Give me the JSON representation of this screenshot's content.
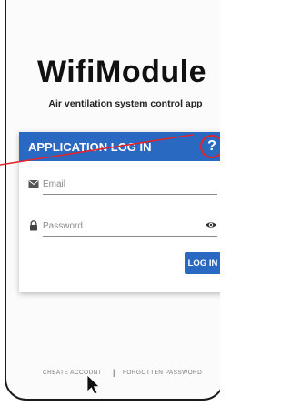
{
  "app": {
    "title": "WifiModule",
    "subtitle": "Air ventilation system control app"
  },
  "card": {
    "title": "APPLICATION LOG IN",
    "help_label": "?"
  },
  "form": {
    "email_placeholder": "Email",
    "password_placeholder": "Password",
    "login_label": "LOG IN"
  },
  "footer": {
    "create_account": "CREATE ACCOUNT",
    "separator": "|",
    "forgotten_password": "FORGOTTEN PASSWORD"
  },
  "icons": {
    "email": "email-icon",
    "password": "lock-icon",
    "show_password": "eye-icon",
    "cursor": "cursor-icon"
  },
  "colors": {
    "accent": "#2a69c2",
    "highlight": "#e0242a"
  }
}
